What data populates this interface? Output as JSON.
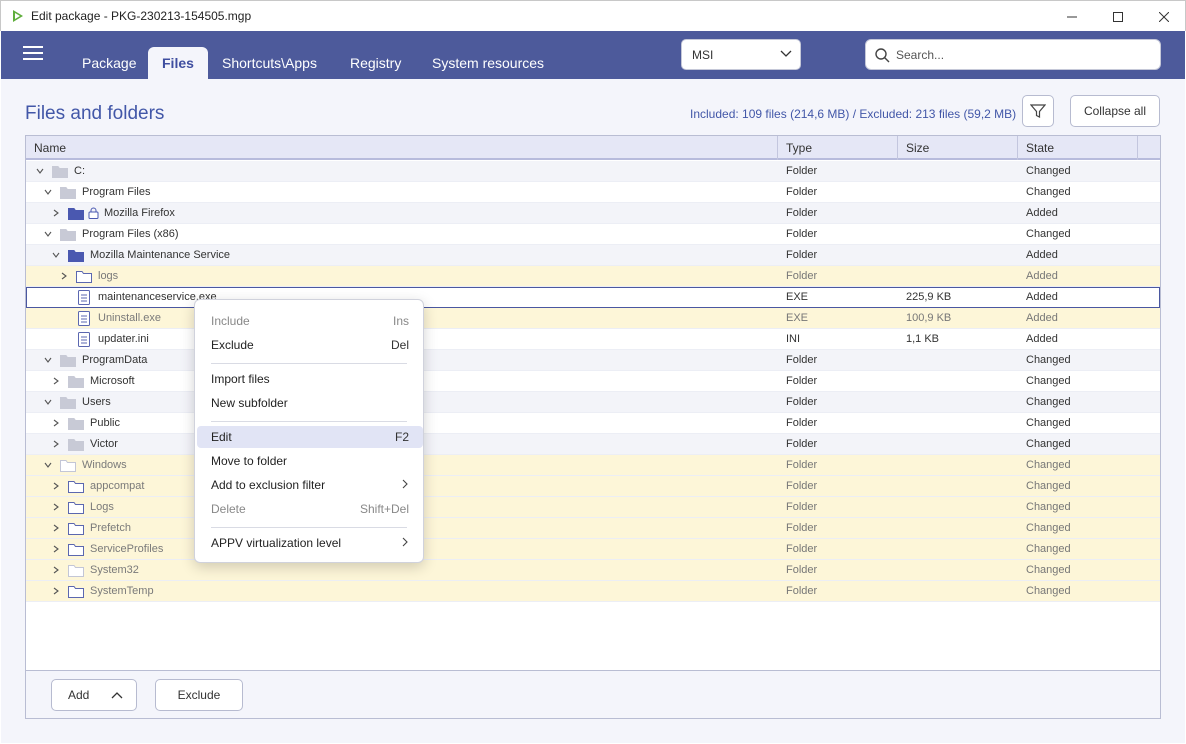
{
  "window": {
    "title": "Edit package - PKG-230213-154505.mgp"
  },
  "nav": {
    "tabs": [
      {
        "label": "Package",
        "active": false
      },
      {
        "label": "Files",
        "active": true
      },
      {
        "label": "Shortcuts\\Apps",
        "active": false
      },
      {
        "label": "Registry",
        "active": false
      },
      {
        "label": "System resources",
        "active": false
      }
    ],
    "package_type": "MSI",
    "search_placeholder": "Search..."
  },
  "page": {
    "title": "Files and folders",
    "summary": "Included: 109 files (214,6 MB) / Excluded: 213 files (59,2 MB)",
    "collapse_label": "Collapse all"
  },
  "grid": {
    "columns": [
      "Name",
      "Type",
      "Size",
      "State"
    ],
    "rows": [
      {
        "name": "C:",
        "level": 0,
        "expander": "down",
        "icon": "folder-gray",
        "type": "Folder",
        "size": "",
        "state": "Changed",
        "style": "odd"
      },
      {
        "name": "Program Files",
        "level": 1,
        "expander": "down",
        "icon": "folder-gray",
        "type": "Folder",
        "size": "",
        "state": "Changed",
        "style": "even"
      },
      {
        "name": "Mozilla Firefox",
        "level": 2,
        "expander": "right",
        "icon": "folder-blue-lock",
        "type": "Folder",
        "size": "",
        "state": "Added",
        "style": "odd"
      },
      {
        "name": "Program Files (x86)",
        "level": 1,
        "expander": "down",
        "icon": "folder-gray",
        "type": "Folder",
        "size": "",
        "state": "Changed",
        "style": "even"
      },
      {
        "name": "Mozilla Maintenance Service",
        "level": 2,
        "expander": "down",
        "icon": "folder-blue",
        "type": "Folder",
        "size": "",
        "state": "Added",
        "style": "odd"
      },
      {
        "name": "logs",
        "level": 3,
        "expander": "right",
        "icon": "folder-outline",
        "type": "Folder",
        "size": "",
        "state": "Added",
        "style": "yellow"
      },
      {
        "name": "maintenanceservice.exe",
        "level": 3,
        "expander": "none",
        "icon": "file",
        "type": "EXE",
        "size": "225,9 KB",
        "state": "Added",
        "style": "even selected"
      },
      {
        "name": "Uninstall.exe",
        "level": 3,
        "expander": "none",
        "icon": "file",
        "type": "EXE",
        "size": "100,9 KB",
        "state": "Added",
        "style": "yellow"
      },
      {
        "name": "updater.ini",
        "level": 3,
        "expander": "none",
        "icon": "file",
        "type": "INI",
        "size": "1,1 KB",
        "state": "Added",
        "style": "even"
      },
      {
        "name": "ProgramData",
        "level": 1,
        "expander": "down",
        "icon": "folder-gray",
        "type": "Folder",
        "size": "",
        "state": "Changed",
        "style": "odd"
      },
      {
        "name": "Microsoft",
        "level": 2,
        "expander": "right",
        "icon": "folder-gray",
        "type": "Folder",
        "size": "",
        "state": "Changed",
        "style": "even"
      },
      {
        "name": "Users",
        "level": 1,
        "expander": "down",
        "icon": "folder-gray",
        "type": "Folder",
        "size": "",
        "state": "Changed",
        "style": "odd"
      },
      {
        "name": "Public",
        "level": 2,
        "expander": "right",
        "icon": "folder-gray",
        "type": "Folder",
        "size": "",
        "state": "Changed",
        "style": "even"
      },
      {
        "name": "Victor",
        "level": 2,
        "expander": "right",
        "icon": "folder-gray",
        "type": "Folder",
        "size": "",
        "state": "Changed",
        "style": "odd"
      },
      {
        "name": "Windows",
        "level": 1,
        "expander": "down",
        "icon": "folder-outline-light",
        "type": "Folder",
        "size": "",
        "state": "Changed",
        "style": "yellow"
      },
      {
        "name": "appcompat",
        "level": 2,
        "expander": "right",
        "icon": "folder-outline",
        "type": "Folder",
        "size": "",
        "state": "Changed",
        "style": "yellow"
      },
      {
        "name": "Logs",
        "level": 2,
        "expander": "right",
        "icon": "folder-outline",
        "type": "Folder",
        "size": "",
        "state": "Changed",
        "style": "yellow"
      },
      {
        "name": "Prefetch",
        "level": 2,
        "expander": "right",
        "icon": "folder-outline",
        "type": "Folder",
        "size": "",
        "state": "Changed",
        "style": "yellow"
      },
      {
        "name": "ServiceProfiles",
        "level": 2,
        "expander": "right",
        "icon": "folder-outline",
        "type": "Folder",
        "size": "",
        "state": "Changed",
        "style": "yellow"
      },
      {
        "name": "System32",
        "level": 2,
        "expander": "right",
        "icon": "folder-outline-light",
        "type": "Folder",
        "size": "",
        "state": "Changed",
        "style": "yellow"
      },
      {
        "name": "SystemTemp",
        "level": 2,
        "expander": "right",
        "icon": "folder-outline",
        "type": "Folder",
        "size": "",
        "state": "Changed",
        "style": "yellow"
      }
    ]
  },
  "bottom": {
    "add_label": "Add",
    "exclude_label": "Exclude"
  },
  "context_menu": {
    "items": [
      {
        "label": "Include",
        "shortcut": "Ins",
        "disabled": true
      },
      {
        "label": "Exclude",
        "shortcut": "Del",
        "disabled": false
      },
      {
        "separator": true
      },
      {
        "label": "Import files",
        "shortcut": "",
        "disabled": false
      },
      {
        "label": "New subfolder",
        "shortcut": "",
        "disabled": false
      },
      {
        "separator": true
      },
      {
        "label": "Edit",
        "shortcut": "F2",
        "disabled": false,
        "highlighted": true
      },
      {
        "label": "Move to folder",
        "shortcut": "",
        "disabled": false
      },
      {
        "label": "Add to exclusion filter",
        "shortcut": "",
        "submenu": true,
        "disabled": false
      },
      {
        "label": "Delete",
        "shortcut": "Shift+Del",
        "disabled": true
      },
      {
        "separator": true
      },
      {
        "label": "APPV virtualization level",
        "shortcut": "",
        "submenu": true,
        "disabled": false
      }
    ]
  },
  "colors": {
    "nav_bg": "#4d5a9b",
    "accent": "#4257a8",
    "folder_blue": "#4a58b0",
    "folder_gray": "#c8cad6",
    "excluded_row": "#fdf6d8"
  }
}
